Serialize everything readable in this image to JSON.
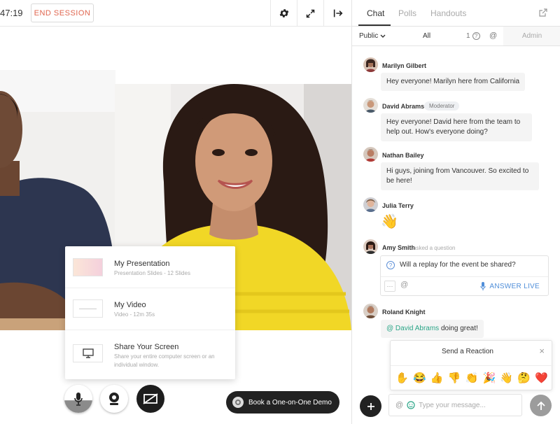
{
  "session": {
    "timer": "47:19",
    "end_label": "END SESSION"
  },
  "share_menu": {
    "items": [
      {
        "title": "My Presentation",
        "subtitle": "Presentation Slides - 12 Slides"
      },
      {
        "title": "My Video",
        "subtitle": "Video - 12m 35s"
      },
      {
        "title": "Share Your Screen",
        "subtitle": "Share your entire computer screen or an individual window."
      }
    ]
  },
  "book_demo": {
    "label": "Book a One-on-One Demo"
  },
  "panel": {
    "tabs": [
      "Chat",
      "Polls",
      "Handouts"
    ],
    "filters": {
      "visibility": "Public",
      "all": "All",
      "question_count": "1",
      "at": "@",
      "admin": "Admin"
    }
  },
  "messages": [
    {
      "name": "Marilyn Gilbert",
      "text": "Hey everyone! Marilyn here from California"
    },
    {
      "name": "David Abrams",
      "role": "Moderator",
      "text": "Hey everyone! David here from the team to help out. How's everyone doing?"
    },
    {
      "name": "Nathan Bailey",
      "text": "Hi guys, joining from Vancouver. So excited to be here!"
    },
    {
      "name": "Julia Terry",
      "text": "👋"
    },
    {
      "name": "Amy Smith",
      "asked": "asked a question",
      "text": "Will a replay for the event be shared?"
    },
    {
      "name": "Roland Knight",
      "mention": "@ David Abrams",
      "text": " doing great!"
    }
  ],
  "question": {
    "more": "···",
    "at": "@",
    "answer_label": "ANSWER LIVE"
  },
  "reaction": {
    "title": "Send a Reaction",
    "close": "×",
    "emojis": [
      "✋",
      "😂",
      "👍",
      "👎",
      "👏",
      "🎉",
      "👋",
      "🤔",
      "❤️"
    ]
  },
  "composer": {
    "at": "@",
    "placeholder": "Type your message..."
  },
  "colors": {
    "accent_green": "#2aa587",
    "accent_blue": "#4f8ed9",
    "end_session_red": "#e0664f"
  }
}
